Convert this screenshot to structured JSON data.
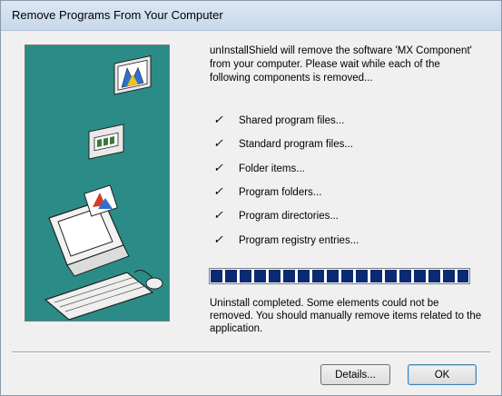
{
  "window": {
    "title": "Remove Programs From Your Computer"
  },
  "message": "unInstallShield will remove the software 'MX Component' from your computer.  Please wait while each of the following components is removed...",
  "components": [
    {
      "check": "✓",
      "label": "Shared program files..."
    },
    {
      "check": "✓",
      "label": "Standard program files..."
    },
    {
      "check": "✓",
      "label": "Folder items..."
    },
    {
      "check": "✓",
      "label": "Program folders..."
    },
    {
      "check": "✓",
      "label": "Program directories..."
    },
    {
      "check": "✓",
      "label": "Program registry entries..."
    }
  ],
  "progress": {
    "fraction": 1.0
  },
  "status": "Uninstall completed.  Some elements could not be removed.  You should manually remove items related to the application.",
  "buttons": {
    "details": "Details...",
    "ok": "OK"
  },
  "colors": {
    "art_background": "#2b8c87",
    "progress_fill": "#0a2a73"
  }
}
